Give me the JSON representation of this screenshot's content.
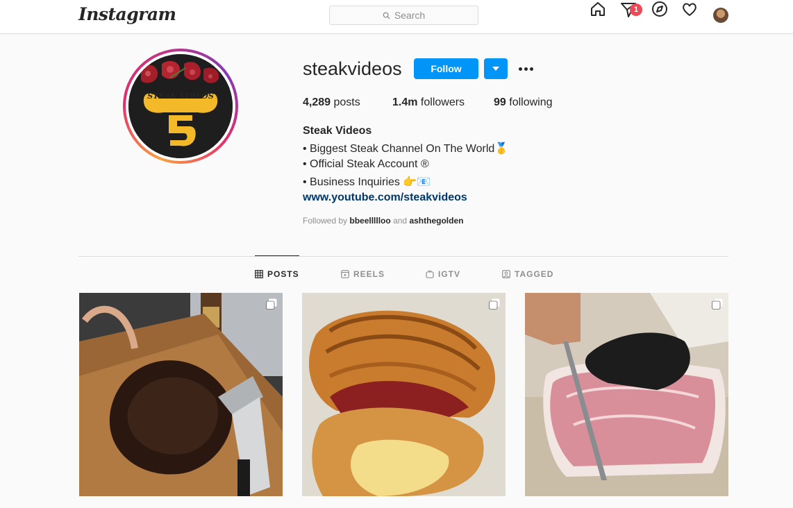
{
  "nav": {
    "logo": "Instagram",
    "search_placeholder": "Search",
    "notification_count": "1",
    "icons": [
      "home-icon",
      "direct-message-icon",
      "explore-icon",
      "activity-heart-icon",
      "profile-avatar"
    ]
  },
  "profile": {
    "username": "steakvideos",
    "follow_label": "Follow",
    "avatar_text": "STEAK VIDEOS",
    "stats": {
      "posts_count": "4,289",
      "posts_label": "posts",
      "followers_count": "1.4m",
      "followers_label": "followers",
      "following_count": "99",
      "following_label": "following"
    },
    "bio": {
      "name": "Steak Videos",
      "lines": [
        "• Biggest Steak Channel On The World🥇",
        "• Official Steak Account ®",
        "• Business Inquiries 👉📧"
      ],
      "link": "www.youtube.com/steakvideos"
    },
    "followed_by": {
      "prefix": "Followed by",
      "user1": "bbeellllloo",
      "conjunction": "and",
      "user2": "ashthegolden"
    }
  },
  "tabs": [
    {
      "label": "POSTS",
      "active": true
    },
    {
      "label": "REELS",
      "active": false
    },
    {
      "label": "IGTV",
      "active": false
    },
    {
      "label": "TAGGED",
      "active": false
    }
  ],
  "posts": [
    {
      "subject": "grilled tomahawk steak on cutting board",
      "multi": true
    },
    {
      "subject": "steak croissant sandwich",
      "multi": true
    },
    {
      "subject": "wagyu steak being sliced with gloved hand",
      "multi": true
    }
  ],
  "colors": {
    "accent": "#0095f6",
    "link": "#00376b",
    "badge": "#ed4956",
    "text": "#262626",
    "muted": "#8e8e8e",
    "border": "#dbdbdb",
    "background": "#fafafa"
  }
}
